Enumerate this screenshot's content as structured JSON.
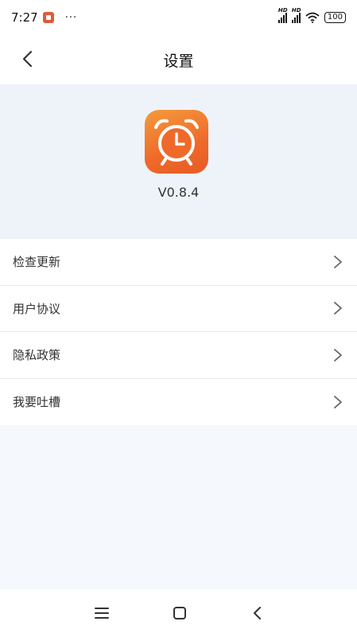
{
  "status_bar": {
    "time": "7:27",
    "dots": "···",
    "battery": "100",
    "icons": [
      "app-notification-icon",
      "signal-hd-icon",
      "signal-hd-icon",
      "wifi-icon",
      "battery-icon"
    ]
  },
  "header": {
    "title": "设置",
    "back_icon": "chevron-left-icon"
  },
  "app_info": {
    "icon": "alarm-clock-icon",
    "icon_colors": [
      "#f59a3c",
      "#e65a24"
    ],
    "version": "V0.8.4"
  },
  "menu": {
    "items": [
      {
        "label": "检查更新",
        "icon": "chevron-right-icon"
      },
      {
        "label": "用户协议",
        "icon": "chevron-right-icon"
      },
      {
        "label": "隐私政策",
        "icon": "chevron-right-icon"
      },
      {
        "label": "我要吐槽",
        "icon": "chevron-right-icon"
      }
    ]
  },
  "nav_bar": {
    "icons": [
      "menu-icon",
      "home-icon",
      "back-icon"
    ]
  },
  "colors": {
    "background": "#f5f8fc",
    "hero_background": "#eef3f9",
    "accent": "#ef6a2a"
  }
}
